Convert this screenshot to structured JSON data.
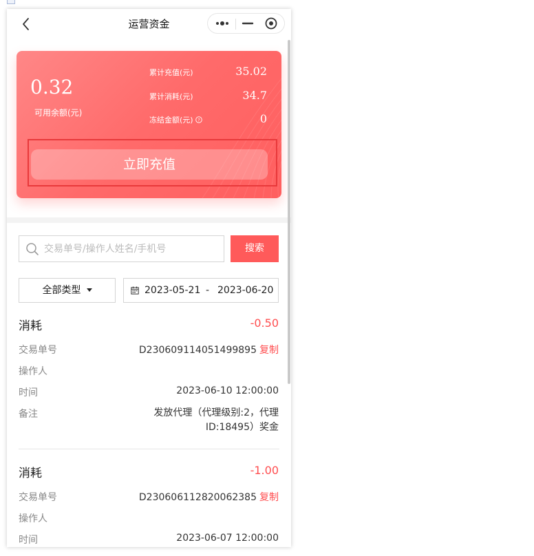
{
  "nav": {
    "title": "运营资金",
    "back_icon": "chevron-left-icon",
    "more_icon": "more-dots-icon",
    "minimize_icon": "minimize-icon",
    "close_icon": "target-circle-icon"
  },
  "card": {
    "balance": "0.32",
    "balance_label": "可用余额(元)",
    "stats": [
      {
        "label": "累计充值(元)",
        "value": "35.02"
      },
      {
        "label": "累计消耗(元)",
        "value": "34.7"
      },
      {
        "label": "冻结金额(元)",
        "value": "0",
        "icon": "question-circle-icon"
      }
    ],
    "recharge_label": "立即充值"
  },
  "search": {
    "placeholder": "交易单号/操作人姓名/手机号",
    "value": "",
    "button_label": "搜索",
    "icon": "search-icon"
  },
  "filters": {
    "type_selected": "全部类型",
    "date_start": "2023-05-21",
    "date_separator": "-",
    "date_end": "2023-06-20",
    "calendar_icon": "calendar-icon"
  },
  "records": [
    {
      "type": "消耗",
      "amount": "-0.50",
      "order_label": "交易单号",
      "order_no": "D230609114051499895",
      "copy_label": "复制",
      "operator_label": "操作人",
      "operator": "",
      "time_label": "时间",
      "time": "2023-06-10 12:00:00",
      "note_label": "备注",
      "note": "发放代理（代理级别:2，代理ID:18495）奖金"
    },
    {
      "type": "消耗",
      "amount": "-1.00",
      "order_label": "交易单号",
      "order_no": "D230606112820062385",
      "copy_label": "复制",
      "operator_label": "操作人",
      "operator": "",
      "time_label": "时间",
      "time": "2023-06-07 12:00:00"
    }
  ],
  "colors": {
    "accent": "#ff5a5a",
    "amount_negative": "#ff4d4f",
    "highlight_border": "#e8393b"
  }
}
